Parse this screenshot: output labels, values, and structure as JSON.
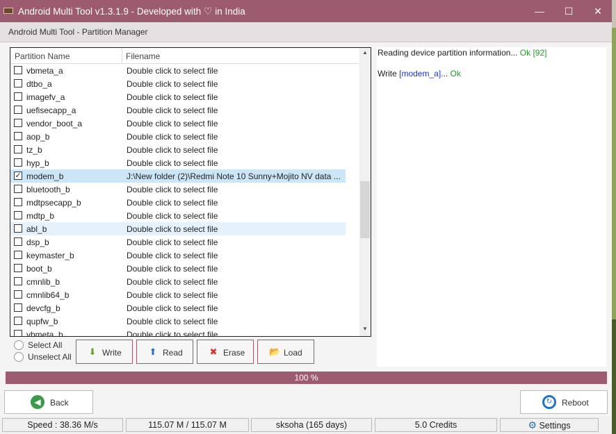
{
  "titlebar": {
    "title_pre": "Android Multi Tool v1.3.1.9 - Developed with ",
    "title_post": " in India",
    "heart": "♡",
    "minimize": "—",
    "maximize": "☐",
    "close": "✕"
  },
  "subtitle": "Android Multi Tool - Partition Manager",
  "table": {
    "col_partition": "Partition Name",
    "col_filename": "Filename",
    "rows": [
      {
        "name": "vbmeta_a",
        "file": "Double click to select file",
        "checked": false
      },
      {
        "name": "dtbo_a",
        "file": "Double click to select file",
        "checked": false
      },
      {
        "name": "imagefv_a",
        "file": "Double click to select file",
        "checked": false
      },
      {
        "name": "uefisecapp_a",
        "file": "Double click to select file",
        "checked": false
      },
      {
        "name": "vendor_boot_a",
        "file": "Double click to select file",
        "checked": false
      },
      {
        "name": "aop_b",
        "file": "Double click to select file",
        "checked": false
      },
      {
        "name": "tz_b",
        "file": "Double click to select file",
        "checked": false
      },
      {
        "name": "hyp_b",
        "file": "Double click to select file",
        "checked": false
      },
      {
        "name": "modem_b",
        "file": "J:\\New folder (2)\\Redmi Note 10 Sunny+Mojito NV data ...",
        "checked": true
      },
      {
        "name": "bluetooth_b",
        "file": "Double click to select file",
        "checked": false
      },
      {
        "name": "mdtpsecapp_b",
        "file": "Double click to select file",
        "checked": false
      },
      {
        "name": "mdtp_b",
        "file": "Double click to select file",
        "checked": false
      },
      {
        "name": "abl_b",
        "file": "Double click to select file",
        "checked": false
      },
      {
        "name": "dsp_b",
        "file": "Double click to select file",
        "checked": false
      },
      {
        "name": "keymaster_b",
        "file": "Double click to select file",
        "checked": false
      },
      {
        "name": "boot_b",
        "file": "Double click to select file",
        "checked": false
      },
      {
        "name": "cmnlib_b",
        "file": "Double click to select file",
        "checked": false
      },
      {
        "name": "cmnlib64_b",
        "file": "Double click to select file",
        "checked": false
      },
      {
        "name": "devcfg_b",
        "file": "Double click to select file",
        "checked": false
      },
      {
        "name": "qupfw_b",
        "file": "Double click to select file",
        "checked": false
      },
      {
        "name": "vbmeta_b",
        "file": "Double click to select file",
        "checked": false
      }
    ]
  },
  "select_all": "Select All",
  "unselect_all": "Unselect All",
  "buttons": {
    "write": "Write",
    "read": "Read",
    "erase": "Erase",
    "load": "Load"
  },
  "log": {
    "line1_text": "Reading device partition information... ",
    "line1_ok": "Ok [92]",
    "line2_pre": "Write ",
    "line2_target": "[modem_a]",
    "line2_mid": "... ",
    "line2_ok": "Ok"
  },
  "progress": {
    "value": 100,
    "label": "100 %"
  },
  "back": "Back",
  "reboot": "Reboot",
  "status": {
    "speed": "Speed : 38.36 M/s",
    "size": "115.07 M / 115.07 M",
    "user": "sksoha (165 days)",
    "credits": "5.0 Credits",
    "settings": "Settings"
  },
  "colors": {
    "accent": "#9d5b6f",
    "ok": "#1f9d1f",
    "link": "#2233cc"
  }
}
